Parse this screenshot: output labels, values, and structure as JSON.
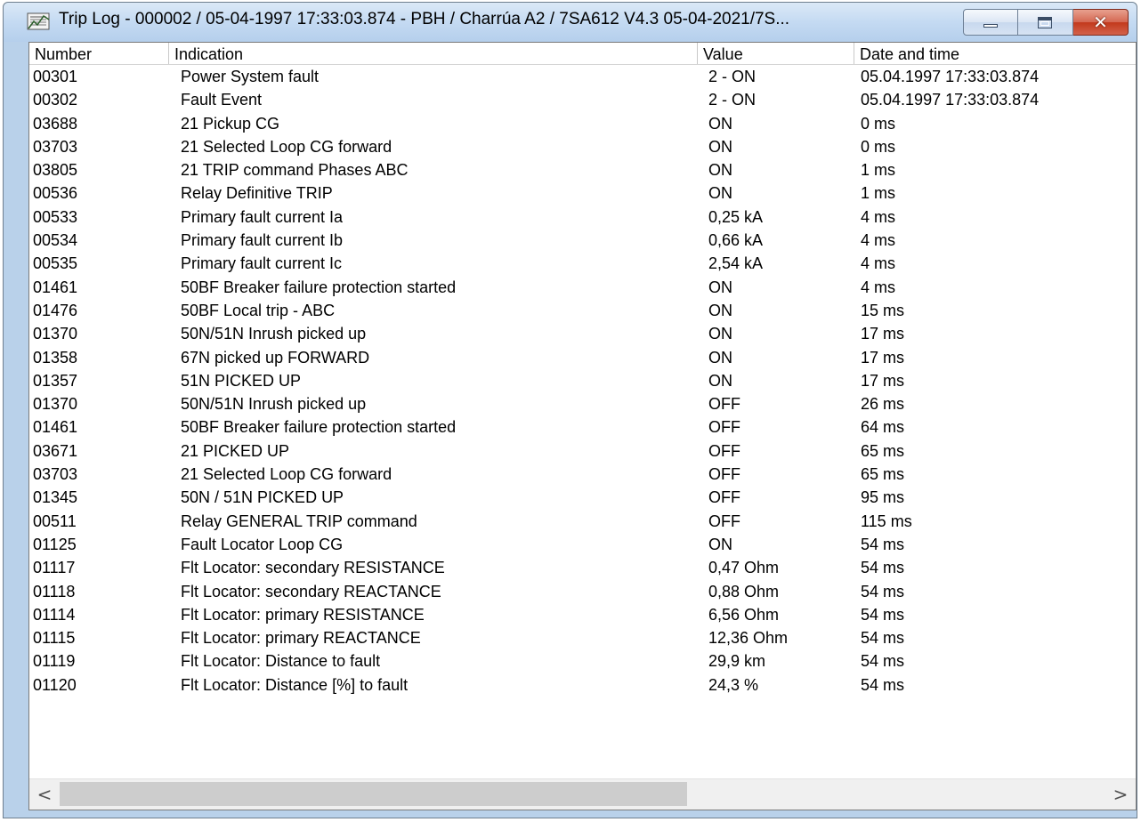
{
  "window": {
    "title": "Trip Log - 000002 / 05-04-1997  17:33:03.874 - PBH / Charrúa A2 / 7SA612 V4.3  05-04-2021/7S...",
    "icon": "trip-log-app-icon",
    "controls": {
      "minimize_icon": "minimize-icon",
      "maximize_icon": "maximize-icon",
      "close_glyph": "✕"
    }
  },
  "table": {
    "columns": [
      "Number",
      "Indication",
      "Value",
      "Date and time"
    ],
    "rows": [
      {
        "number": "00301",
        "indication": "Power System fault",
        "value": "2 - ON",
        "datetime": "05.04.1997  17:33:03.874"
      },
      {
        "number": "00302",
        "indication": "Fault Event",
        "value": "2 - ON",
        "datetime": "05.04.1997  17:33:03.874"
      },
      {
        "number": "03688",
        "indication": "21 Pickup CG",
        "value": "ON",
        "datetime": "0 ms"
      },
      {
        "number": "03703",
        "indication": "21 Selected Loop CG forward",
        "value": "ON",
        "datetime": "0 ms"
      },
      {
        "number": "03805",
        "indication": "21 TRIP command Phases ABC",
        "value": "ON",
        "datetime": "1 ms"
      },
      {
        "number": "00536",
        "indication": "Relay Definitive TRIP",
        "value": "ON",
        "datetime": "1 ms"
      },
      {
        "number": "00533",
        "indication": "Primary fault current Ia",
        "value": "0,25 kA",
        "datetime": "4 ms"
      },
      {
        "number": "00534",
        "indication": "Primary fault current Ib",
        "value": "0,66 kA",
        "datetime": "4 ms"
      },
      {
        "number": "00535",
        "indication": "Primary fault current Ic",
        "value": "2,54 kA",
        "datetime": "4 ms"
      },
      {
        "number": "01461",
        "indication": "50BF Breaker failure protection started",
        "value": "ON",
        "datetime": "4 ms"
      },
      {
        "number": "01476",
        "indication": "50BF Local trip -  ABC",
        "value": "ON",
        "datetime": "15 ms"
      },
      {
        "number": "01370",
        "indication": "50N/51N Inrush picked up",
        "value": "ON",
        "datetime": "17 ms"
      },
      {
        "number": "01358",
        "indication": "67N picked up FORWARD",
        "value": "ON",
        "datetime": "17 ms"
      },
      {
        "number": "01357",
        "indication": "51N PICKED UP",
        "value": "ON",
        "datetime": "17 ms"
      },
      {
        "number": "01370",
        "indication": "50N/51N Inrush picked up",
        "value": "OFF",
        "datetime": "26 ms"
      },
      {
        "number": "01461",
        "indication": "50BF Breaker failure protection started",
        "value": "OFF",
        "datetime": "64 ms"
      },
      {
        "number": "03671",
        "indication": "21 PICKED UP",
        "value": "OFF",
        "datetime": "65 ms"
      },
      {
        "number": "03703",
        "indication": "21 Selected Loop CG forward",
        "value": "OFF",
        "datetime": "65 ms"
      },
      {
        "number": "01345",
        "indication": "50N / 51N PICKED UP",
        "value": "OFF",
        "datetime": "95 ms"
      },
      {
        "number": "00511",
        "indication": "Relay GENERAL TRIP command",
        "value": "OFF",
        "datetime": "115 ms"
      },
      {
        "number": "01125",
        "indication": "Fault Locator Loop CG",
        "value": "ON",
        "datetime": "54 ms"
      },
      {
        "number": "01117",
        "indication": "Flt Locator: secondary RESISTANCE",
        "value": "0,47 Ohm",
        "datetime": "54 ms"
      },
      {
        "number": "01118",
        "indication": "Flt Locator: secondary REACTANCE",
        "value": "0,88 Ohm",
        "datetime": "54 ms"
      },
      {
        "number": "01114",
        "indication": "Flt Locator: primary RESISTANCE",
        "value": "6,56 Ohm",
        "datetime": "54 ms"
      },
      {
        "number": "01115",
        "indication": "Flt Locator: primary REACTANCE",
        "value": "12,36 Ohm",
        "datetime": "54 ms"
      },
      {
        "number": "01119",
        "indication": "Flt Locator: Distance to fault",
        "value": "29,9 km",
        "datetime": "54 ms"
      },
      {
        "number": "01120",
        "indication": "Flt Locator: Distance [%] to fault",
        "value": "24,3 %",
        "datetime": "54 ms"
      }
    ]
  },
  "scrollbar": {
    "left_arrow": "<",
    "right_arrow": ">",
    "thumb_fraction": 0.6
  }
}
